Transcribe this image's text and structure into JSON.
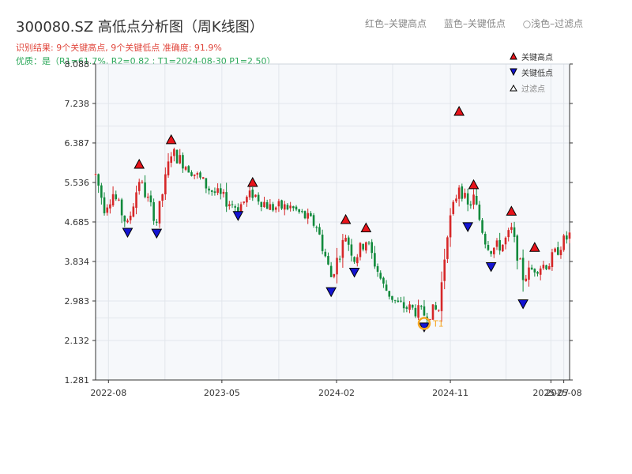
{
  "title": "300080.SZ 高低点分析图（周K线图）",
  "header_legend": [
    "红色–关键高点",
    "蓝色–关键低点",
    "○浅色–过滤点"
  ],
  "result_text": "识别结果: 9个关键高点, 9个关键低点   准确度: 91.9%",
  "quality_text": "优质：是（R1=61.7%, R2=0.82 ; T1=2024-08-30 P1=2.50）",
  "colors": {
    "up": "#d62728",
    "down": "#118a3c",
    "high": "#e8141b",
    "low": "#1414d2",
    "t1": "#f5a623"
  },
  "chart_data": {
    "type": "candlestick",
    "frequency": "weekly",
    "ylim": [
      1.281,
      8.088
    ],
    "yticks": [
      1.281,
      2.132,
      2.983,
      3.834,
      4.685,
      5.536,
      6.387,
      7.238,
      8.088
    ],
    "xticks": [
      "2022-08",
      "2023-05",
      "2024-02",
      "2024-11",
      "2025-07",
      "2025-08"
    ],
    "date_range": [
      "2022-07-01",
      "2025-08-15"
    ],
    "legend": [
      "关键高点",
      "关键低点",
      "过滤点"
    ],
    "key_highs": [
      {
        "date": "2022-10-14",
        "price": 5.79
      },
      {
        "date": "2022-12-30",
        "price": 6.32
      },
      {
        "date": "2023-07-14",
        "price": 5.4
      },
      {
        "date": "2024-02-23",
        "price": 4.6
      },
      {
        "date": "2024-04-12",
        "price": 4.42
      },
      {
        "date": "2024-11-22",
        "price": 6.93
      },
      {
        "date": "2024-12-27",
        "price": 5.35
      },
      {
        "date": "2025-03-28",
        "price": 4.78
      },
      {
        "date": "2025-05-23",
        "price": 4.0
      }
    ],
    "key_lows": [
      {
        "date": "2022-09-16",
        "price": 4.6
      },
      {
        "date": "2022-11-25",
        "price": 4.58
      },
      {
        "date": "2023-06-09",
        "price": 4.96
      },
      {
        "date": "2024-01-19",
        "price": 3.32
      },
      {
        "date": "2024-03-15",
        "price": 3.74
      },
      {
        "date": "2024-08-30",
        "price": 2.56
      },
      {
        "date": "2024-12-13",
        "price": 4.72
      },
      {
        "date": "2025-02-07",
        "price": 3.86
      },
      {
        "date": "2025-04-25",
        "price": 3.06
      }
    ],
    "t1": {
      "label": "T1",
      "date": "2024-08-30",
      "price": 2.5
    },
    "price_path": [
      [
        "2022-07-01",
        5.7
      ],
      [
        "2022-07-22",
        5.0
      ],
      [
        "2022-08-12",
        5.3
      ],
      [
        "2022-09-16",
        4.6
      ],
      [
        "2022-10-14",
        5.6
      ],
      [
        "2022-11-25",
        4.7
      ],
      [
        "2022-12-30",
        6.2
      ],
      [
        "2023-02-17",
        5.8
      ],
      [
        "2023-03-31",
        5.4
      ],
      [
        "2023-05-19",
        5.1
      ],
      [
        "2023-06-09",
        5.0
      ],
      [
        "2023-07-14",
        5.3
      ],
      [
        "2023-08-25",
        5.0
      ],
      [
        "2023-10-13",
        5.0
      ],
      [
        "2023-11-17",
        4.8
      ],
      [
        "2023-12-15",
        4.6
      ],
      [
        "2024-01-19",
        3.5
      ],
      [
        "2024-02-23",
        4.4
      ],
      [
        "2024-03-15",
        3.9
      ],
      [
        "2024-04-12",
        4.3
      ],
      [
        "2024-05-24",
        3.3
      ],
      [
        "2024-06-28",
        2.9
      ],
      [
        "2024-08-02",
        2.8
      ],
      [
        "2024-08-30",
        2.7
      ],
      [
        "2024-10-04",
        2.8
      ],
      [
        "2024-10-25",
        4.5
      ],
      [
        "2024-11-22",
        5.5
      ],
      [
        "2024-12-13",
        5.0
      ],
      [
        "2024-12-27",
        5.2
      ],
      [
        "2025-01-24",
        4.3
      ],
      [
        "2025-02-07",
        4.1
      ],
      [
        "2025-03-07",
        4.2
      ],
      [
        "2025-03-28",
        4.5
      ],
      [
        "2025-04-25",
        3.5
      ],
      [
        "2025-05-23",
        3.7
      ],
      [
        "2025-06-27",
        3.8
      ],
      [
        "2025-07-25",
        4.2
      ],
      [
        "2025-08-15",
        4.4
      ]
    ]
  }
}
